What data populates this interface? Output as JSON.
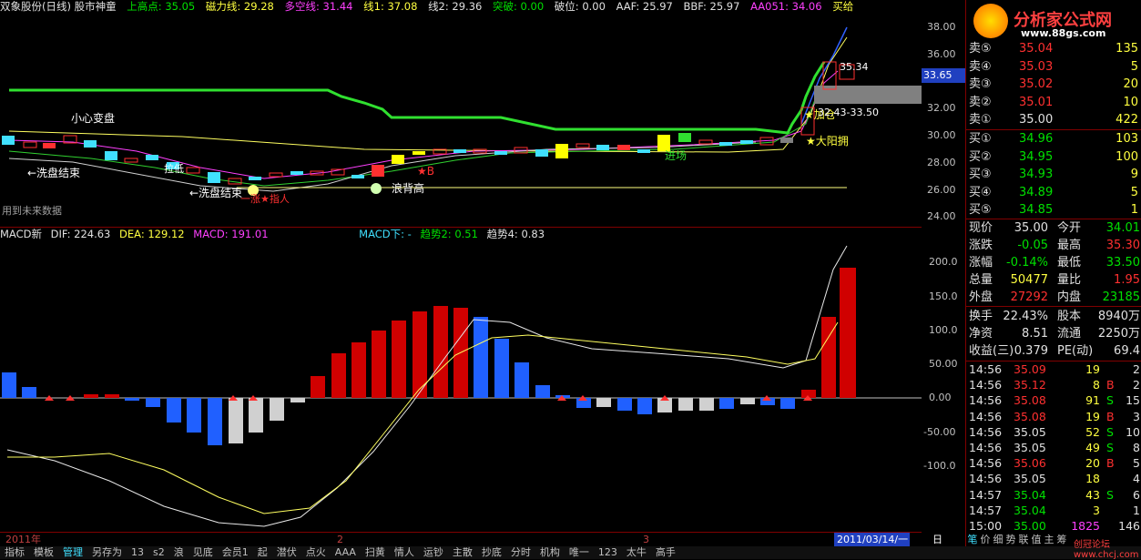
{
  "header": {
    "stock": "双象股份(日线) 股市神童",
    "upper_high": "上高点: 35.05",
    "magnet": "磁力线: 29.28",
    "bullbear": "多空线: 31.44",
    "line1": "线1: 37.08",
    "line2": "线2: 29.36",
    "breakout": "突破: 0.00",
    "breakdown": "破位: 0.00",
    "aaf": "AAF: 25.97",
    "bbf": "BBF: 25.97",
    "aa051": "AA051: 34.06",
    "buy": "买给"
  },
  "main_annotations": {
    "careful": "小心变盘",
    "wash_end_1": "←洗盘结束",
    "wash_end_2": "←洗盘结束",
    "pull_low": "拉低",
    "rise_cycle": "一涨★指人",
    "wave_high": "浪背高",
    "star_b": "★B",
    "enter": "进场",
    "add_pos": "★加仓",
    "big_yang": "★大阳拥",
    "range": "32.43-33.50",
    "peak": "35.34",
    "future": "用到未来数据",
    "price_tag": "33.65"
  },
  "main_scale": [
    "38.00",
    "36.00",
    "34.00",
    "32.00",
    "30.00",
    "28.00",
    "26.00",
    "24.00"
  ],
  "macd_header": {
    "name": "MACD新",
    "dif": "DIF: 224.63",
    "dea": "DEA: 129.12",
    "macd": "MACD: 191.01",
    "macd_down": "MACD下: -",
    "trend2": "趋势2: 0.51",
    "trend4": "趋势4: 0.83"
  },
  "macd_scale": [
    "200.0",
    "150.0",
    "100.0",
    "50.00",
    "0.00",
    "-50.00",
    "-100.0"
  ],
  "date_bar": {
    "year": "2011年",
    "m2": "2",
    "m3": "3",
    "current_date": "2011/03/14/一",
    "period": "日线"
  },
  "tabs": [
    "指标",
    "模板",
    "管理",
    "另存为",
    "13",
    "s2",
    "浪",
    "见底",
    "会员1",
    "起",
    "潜伏",
    "点火",
    "AAA",
    "扫黄",
    "情人",
    "运钞",
    "主散",
    "抄底",
    "分时",
    "机构",
    "唯一",
    "123",
    "太牛",
    "高手"
  ],
  "active_tab": 2,
  "logo": {
    "title": "分析家公式网",
    "url": "www.88gs.com"
  },
  "order_book": {
    "sells": [
      {
        "label": "卖⑤",
        "price": "35.04",
        "vol": "135"
      },
      {
        "label": "卖④",
        "price": "35.03",
        "vol": "5"
      },
      {
        "label": "卖③",
        "price": "35.02",
        "vol": "20"
      },
      {
        "label": "卖②",
        "price": "35.01",
        "vol": "10"
      },
      {
        "label": "卖①",
        "price": "35.00",
        "vol": "422"
      }
    ],
    "buys": [
      {
        "label": "买①",
        "price": "34.96",
        "vol": "103"
      },
      {
        "label": "买②",
        "price": "34.95",
        "vol": "100"
      },
      {
        "label": "买③",
        "price": "34.93",
        "vol": "9"
      },
      {
        "label": "买④",
        "price": "34.89",
        "vol": "5"
      },
      {
        "label": "买⑤",
        "price": "34.85",
        "vol": "1"
      }
    ]
  },
  "stats": [
    {
      "l1": "现价",
      "v1": "35.00",
      "c1": "white",
      "l2": "今开",
      "v2": "34.01",
      "c2": "green"
    },
    {
      "l1": "涨跌",
      "v1": "-0.05",
      "c1": "green",
      "l2": "最高",
      "v2": "35.30",
      "c2": "red"
    },
    {
      "l1": "涨幅",
      "v1": "-0.14%",
      "c1": "green",
      "l2": "最低",
      "v2": "33.50",
      "c2": "green"
    },
    {
      "l1": "总量",
      "v1": "50477",
      "c1": "yellow",
      "l2": "量比",
      "v2": "1.95",
      "c2": "red"
    },
    {
      "l1": "外盘",
      "v1": "27292",
      "c1": "red",
      "l2": "内盘",
      "v2": "23185",
      "c2": "green"
    },
    {
      "l1": "换手",
      "v1": "22.43%",
      "c1": "white",
      "l2": "股本",
      "v2": "8940万",
      "c2": "white"
    },
    {
      "l1": "净资",
      "v1": "8.51",
      "c1": "white",
      "l2": "流通",
      "v2": "2250万",
      "c2": "white"
    },
    {
      "l1": "收益(三)",
      "v1": "0.379",
      "c1": "white",
      "l2": "PE(动)",
      "v2": "69.4",
      "c2": "white"
    }
  ],
  "ticks": [
    {
      "t": "14:56",
      "p": "35.09",
      "pc": "red",
      "v": "19",
      "vc": "yellow",
      "s": "",
      "n": "2"
    },
    {
      "t": "14:56",
      "p": "35.12",
      "pc": "red",
      "v": "8",
      "vc": "yellow",
      "s": "B",
      "sc": "red",
      "n": "2"
    },
    {
      "t": "14:56",
      "p": "35.08",
      "pc": "red",
      "v": "91",
      "vc": "yellow",
      "s": "S",
      "sc": "green",
      "n": "15"
    },
    {
      "t": "14:56",
      "p": "35.08",
      "pc": "red",
      "v": "19",
      "vc": "yellow",
      "s": "B",
      "sc": "red",
      "n": "3"
    },
    {
      "t": "14:56",
      "p": "35.05",
      "pc": "white",
      "v": "52",
      "vc": "yellow",
      "s": "S",
      "sc": "green",
      "n": "10"
    },
    {
      "t": "14:56",
      "p": "35.05",
      "pc": "white",
      "v": "49",
      "vc": "yellow",
      "s": "S",
      "sc": "green",
      "n": "8"
    },
    {
      "t": "14:56",
      "p": "35.06",
      "pc": "red",
      "v": "20",
      "vc": "yellow",
      "s": "B",
      "sc": "red",
      "n": "5"
    },
    {
      "t": "14:56",
      "p": "35.05",
      "pc": "white",
      "v": "18",
      "vc": "yellow",
      "s": "",
      "n": "4"
    },
    {
      "t": "14:57",
      "p": "35.04",
      "pc": "green",
      "v": "43",
      "vc": "yellow",
      "s": "S",
      "sc": "green",
      "n": "6"
    },
    {
      "t": "14:57",
      "p": "35.04",
      "pc": "green",
      "v": "3",
      "vc": "yellow",
      "s": "",
      "n": "1"
    },
    {
      "t": "15:00",
      "p": "35.00",
      "pc": "green",
      "v": "1825",
      "vc": "mag",
      "s": "",
      "n": "146"
    }
  ],
  "bottom_tabs": [
    "笔",
    "价",
    "细",
    "势",
    "联",
    "值",
    "主",
    "筹"
  ],
  "watermark": "创冠论坛 www.chcj.com"
}
